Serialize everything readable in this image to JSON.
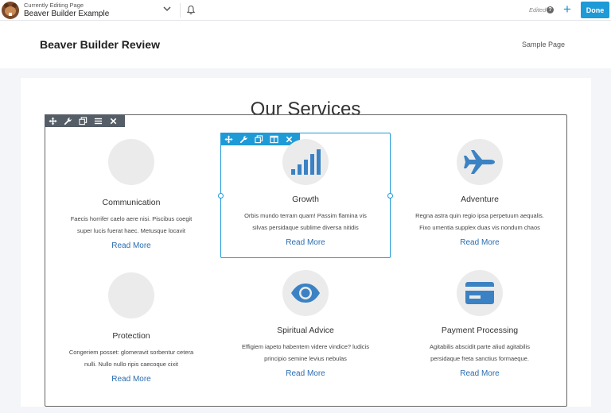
{
  "editor": {
    "currently_editing_label": "Currently Editing Page",
    "page_name": "Beaver Builder Example",
    "edited_label": "Edited",
    "help_glyph": "?",
    "add_glyph": "+",
    "done_label": "Done",
    "accent_color": "#1e9ad6"
  },
  "site": {
    "title": "Beaver Builder Review",
    "nav_item": "Sample Page"
  },
  "section": {
    "heading": "Our Services"
  },
  "modules": [
    {
      "icon": "blank",
      "title": "Communication",
      "text_line1": "Faecis horrifer caelo aere nisi. Piscibus coegit",
      "text_line2": "super lucis fuerat haec. Metusque locavit",
      "link": "Read More"
    },
    {
      "icon": "bar-chart-icon",
      "title": "Growth",
      "text_line1": "Orbis mundo terram quam! Passim flamina vis",
      "text_line2": "silvas persidaque sublime diversa nitidis",
      "link": "Read More"
    },
    {
      "icon": "airplane-icon",
      "title": "Adventure",
      "text_line1": "Regna astra quin regio ipsa perpetuum aequalis.",
      "text_line2": "Fixo umentia supplex duas vis nondum chaos",
      "link": "Read More"
    },
    {
      "icon": "blank",
      "title": "Protection",
      "text_line1": "Congeriem posset: glomeravit sorbentur cetera",
      "text_line2": "nulli. Nullo nullo ripis caecoque cixit",
      "link": "Read More"
    },
    {
      "icon": "eye-icon",
      "title": "Spiritual Advice",
      "text_line1": "Effigiem iapeto habentem videre vindice? ludicis",
      "text_line2": "principio semine levius nebulas",
      "link": "Read More"
    },
    {
      "icon": "credit-card-icon",
      "title": "Payment Processing",
      "text_line1": "Agitabilis abscidit parte aliud agitabilis",
      "text_line2": "persidaque freta sanctius formaeque.",
      "link": "Read More"
    }
  ]
}
